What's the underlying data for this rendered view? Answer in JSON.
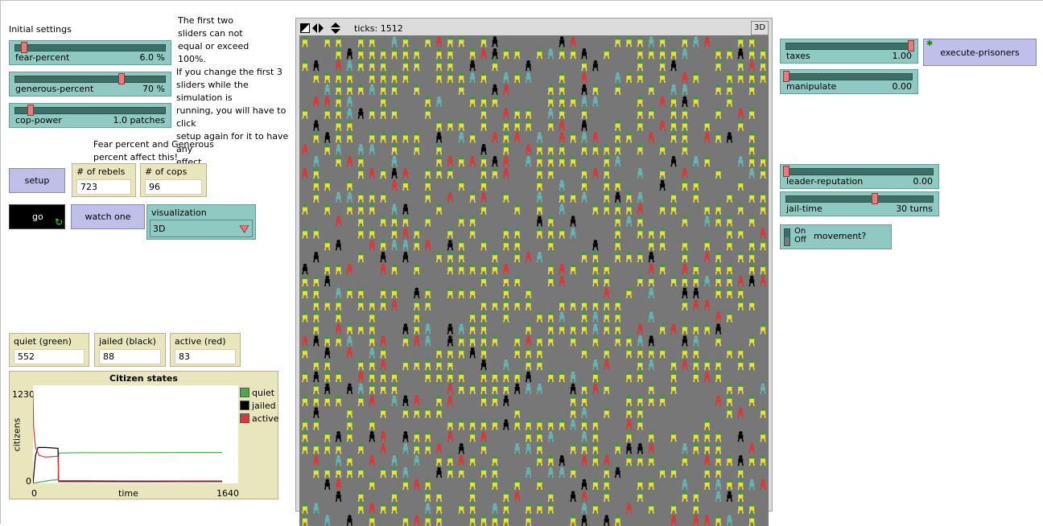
{
  "notes": {
    "initial_settings": "Initial settings",
    "first_two": "The first two\nsliders can not\nequal or exceed\n100%.",
    "change_first_3": "If you change the first 3\nsliders while the simulation is\nrunning, you will have to click\nsetup again for it to have any\neffect",
    "fear_generous": "Fear percent and Generous\npercent affect this!"
  },
  "sliders": {
    "fear": {
      "label": "fear-percent",
      "value": "6.0 %",
      "fraction": 0.06
    },
    "generous": {
      "label": "generous-percent",
      "value": "70 %",
      "fraction": 0.7
    },
    "cop_power": {
      "label": "cop-power",
      "value": "1.0 patches",
      "fraction": 0.1
    },
    "taxes": {
      "label": "taxes",
      "value": "1.00",
      "fraction": 1.0
    },
    "manipulate": {
      "label": "manipulate",
      "value": "0.00",
      "fraction": 0.0
    },
    "leader_reputation": {
      "label": "leader-reputation",
      "value": "0.00",
      "fraction": 0.0
    },
    "jail_time": {
      "label": "jail-time",
      "value": "30 turns",
      "fraction": 0.6
    }
  },
  "buttons": {
    "setup": "setup",
    "go": "go",
    "watch_one": "watch one",
    "execute_prisoners": "execute-prisoners"
  },
  "monitors": {
    "rebels": {
      "label": "# of rebels",
      "value": "723"
    },
    "cops": {
      "label": "# of cops",
      "value": "96"
    },
    "quiet": {
      "label": "quiet (green)",
      "value": "552"
    },
    "jailed": {
      "label": "jailed (black)",
      "value": "88"
    },
    "active": {
      "label": "active (red)",
      "value": "83"
    }
  },
  "chooser": {
    "label": "visualization",
    "value": "3D"
  },
  "switch": {
    "on": "On",
    "off": "Off",
    "label": "movement?",
    "state": "off"
  },
  "view": {
    "ticks_label": "ticks: 1512",
    "three_d": "3D"
  },
  "plot": {
    "title": "Citizen states",
    "ymax_label": "1230",
    "ymin_label": "0",
    "xmin_label": "0",
    "xmax_label": "1640",
    "xlabel": "time",
    "ylabel": "citizens",
    "legend": [
      {
        "name": "quiet",
        "color": "#4ea64e"
      },
      {
        "name": "jailed",
        "color": "#000000"
      },
      {
        "name": "active",
        "color": "#d63a3a"
      }
    ]
  },
  "chart_data": {
    "type": "line",
    "title": "Citizen states",
    "xlabel": "time",
    "ylabel": "citizens",
    "xlim": [
      0,
      1640
    ],
    "ylim": [
      0,
      1230
    ],
    "legend_position": "right",
    "series": [
      {
        "name": "quiet",
        "color": "#4ea64e",
        "x": [
          0,
          30,
          150,
          200,
          205,
          400,
          800,
          1200,
          1512
        ],
        "y": [
          0,
          10,
          40,
          45,
          380,
          385,
          385,
          387,
          387
        ]
      },
      {
        "name": "jailed",
        "color": "#000000",
        "x": [
          0,
          20,
          40,
          100,
          200,
          205,
          400,
          800,
          1200,
          1512
        ],
        "y": [
          0,
          350,
          450,
          450,
          440,
          30,
          30,
          28,
          28,
          28
        ]
      },
      {
        "name": "active",
        "color": "#d63a3a",
        "x": [
          0,
          5,
          20,
          50,
          100,
          200,
          205,
          400,
          800,
          1200,
          1512
        ],
        "y": [
          1150,
          700,
          450,
          350,
          330,
          340,
          20,
          20,
          18,
          20,
          20
        ]
      }
    ]
  },
  "colors": {
    "slider": "#8fc9c2",
    "button": "#bfbfea",
    "monitor": "#e9e5bd",
    "world": "#777777",
    "citizen_quiet": "#e5e33a",
    "citizen_active": "#d63a3a",
    "citizen_jailed": "#000000",
    "cop": "#66b3b0"
  }
}
